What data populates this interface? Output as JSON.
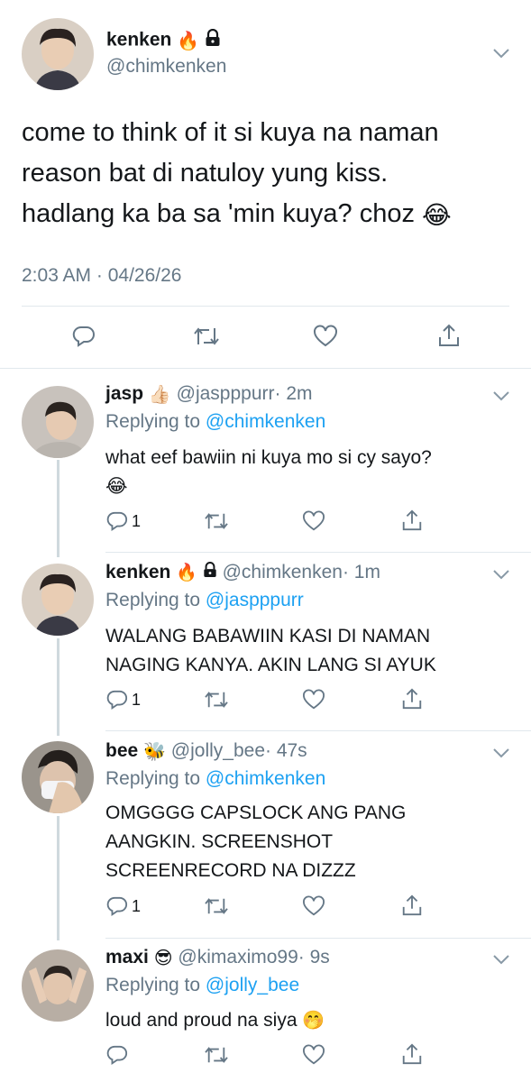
{
  "main_tweet": {
    "display_name": "kenken",
    "handle": "@chimkenken",
    "text_lines": [
      "come to think of it si kuya na naman",
      "reason bat di natuloy yung kiss.",
      "hadlang ka ba sa 'min kuya? choz"
    ],
    "timestamp": "2:03 AM · 04/26/26"
  },
  "replies": [
    {
      "display_name": "jasp",
      "handle": "@jaspppurr",
      "time": "· 2m",
      "replying_label": "Replying to",
      "replying_to": "@chimkenken",
      "text_lines": [
        "what eef bawiin ni kuya mo si cy sayo?"
      ],
      "reply_count": "1"
    },
    {
      "display_name": "kenken",
      "handle": "@chimkenken",
      "time": "· 1m",
      "replying_label": "Replying to",
      "replying_to": "@jaspppurr",
      "text_lines": [
        "WALANG BABAWIIN KASI DI NAMAN",
        "NAGING KANYA. AKIN LANG SI AYUK"
      ],
      "reply_count": "1"
    },
    {
      "display_name": "bee",
      "handle": "@jolly_bee",
      "time": "· 47s",
      "replying_label": "Replying to",
      "replying_to": "@chimkenken",
      "text_lines": [
        "OMGGGG CAPSLOCK ANG PANG",
        "AANGKIN. SCREENSHOT",
        "SCREENRECORD NA DIZZZ"
      ],
      "reply_count": "1"
    },
    {
      "display_name": "maxi",
      "handle": "@kimaximo99",
      "time": "· 9s",
      "replying_label": "Replying to",
      "replying_to": "@jolly_bee",
      "text_lines": [
        "loud and proud na siya"
      ],
      "reply_count": ""
    }
  ],
  "icons": {
    "reply": "reply-icon",
    "retweet": "retweet-icon",
    "like": "heart-icon",
    "share": "share-icon",
    "more": "chevron-down-icon",
    "lock": "lock-icon"
  },
  "colors": {
    "link": "#1da1f2",
    "muted": "#657786",
    "text": "#14171a",
    "divider": "#e1e8ed"
  }
}
